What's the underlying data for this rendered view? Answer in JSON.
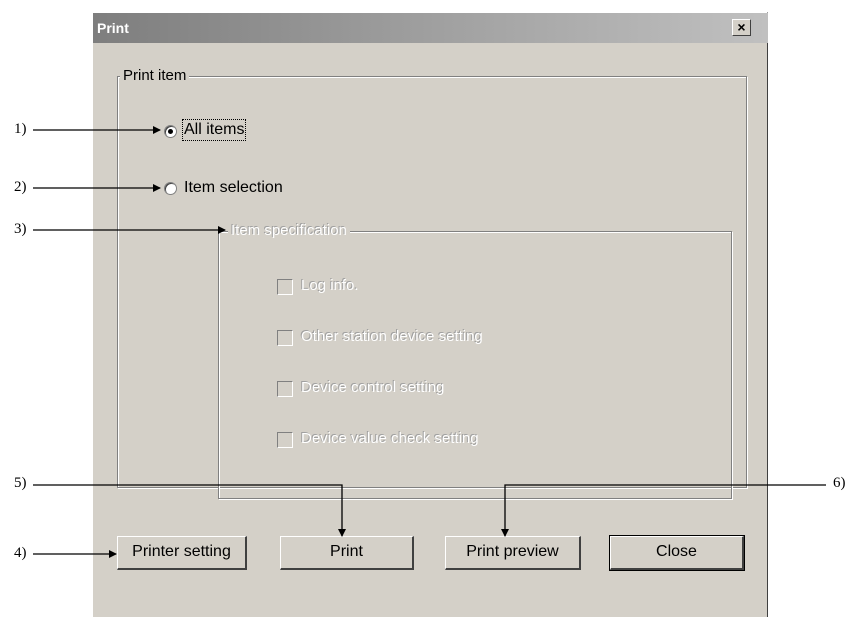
{
  "dialog": {
    "title": "Print",
    "close_glyph": "×",
    "print_item_legend": "Print item",
    "radio_all_items": "All items",
    "radio_item_selection": "Item selection",
    "selected_radio": "All items",
    "item_specification_legend": "Item specification",
    "checkboxes": [
      {
        "label": "Log info.",
        "checked": false,
        "enabled": false
      },
      {
        "label": "Other station device setting",
        "checked": false,
        "enabled": false
      },
      {
        "label": "Device control setting",
        "checked": false,
        "enabled": false
      },
      {
        "label": "Device value check setting",
        "checked": false,
        "enabled": false
      }
    ],
    "buttons": {
      "printer_setting": "Printer setting",
      "print": "Print",
      "print_preview": "Print preview",
      "close": "Close"
    }
  },
  "callouts": {
    "c1": "1)",
    "c2": "2)",
    "c3": "3)",
    "c4": "4)",
    "c5": "5)",
    "c6": "6)"
  }
}
